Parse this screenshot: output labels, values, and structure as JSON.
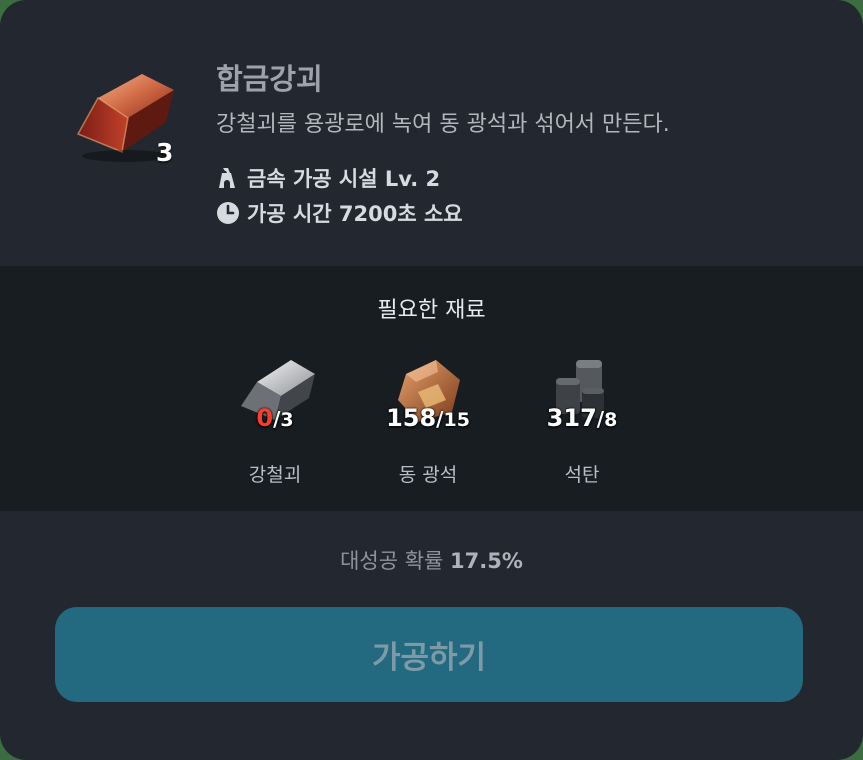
{
  "item": {
    "name": "합금강괴",
    "description": "강철괴를 용광로에 녹여 동 광석과 섞어서 만든다.",
    "count": "3",
    "icon": "alloy-steel-ingot-icon"
  },
  "facility": {
    "icon": "furnace-icon",
    "label": "금속 가공 시설 Lv. 2"
  },
  "craft_time": {
    "icon": "clock-icon",
    "label": "가공 시간 7200초 소요"
  },
  "materials": {
    "title": "필요한 재료",
    "items": [
      {
        "name": "강철괴",
        "have": "0",
        "need": "3",
        "icon": "steel-ingot-icon",
        "insufficient": true
      },
      {
        "name": "동 광석",
        "have": "158",
        "need": "15",
        "icon": "copper-ore-icon",
        "insufficient": false
      },
      {
        "name": "석탄",
        "have": "317",
        "need": "8",
        "icon": "coal-icon",
        "insufficient": false
      }
    ]
  },
  "success": {
    "label": "대성공 확률",
    "value": "17.5%"
  },
  "button": {
    "label": "가공하기"
  },
  "colors": {
    "panel_bg": "#232830",
    "materials_bg": "#181d22",
    "button_bg": "#236a80",
    "insufficient": "#ff3b2f"
  }
}
